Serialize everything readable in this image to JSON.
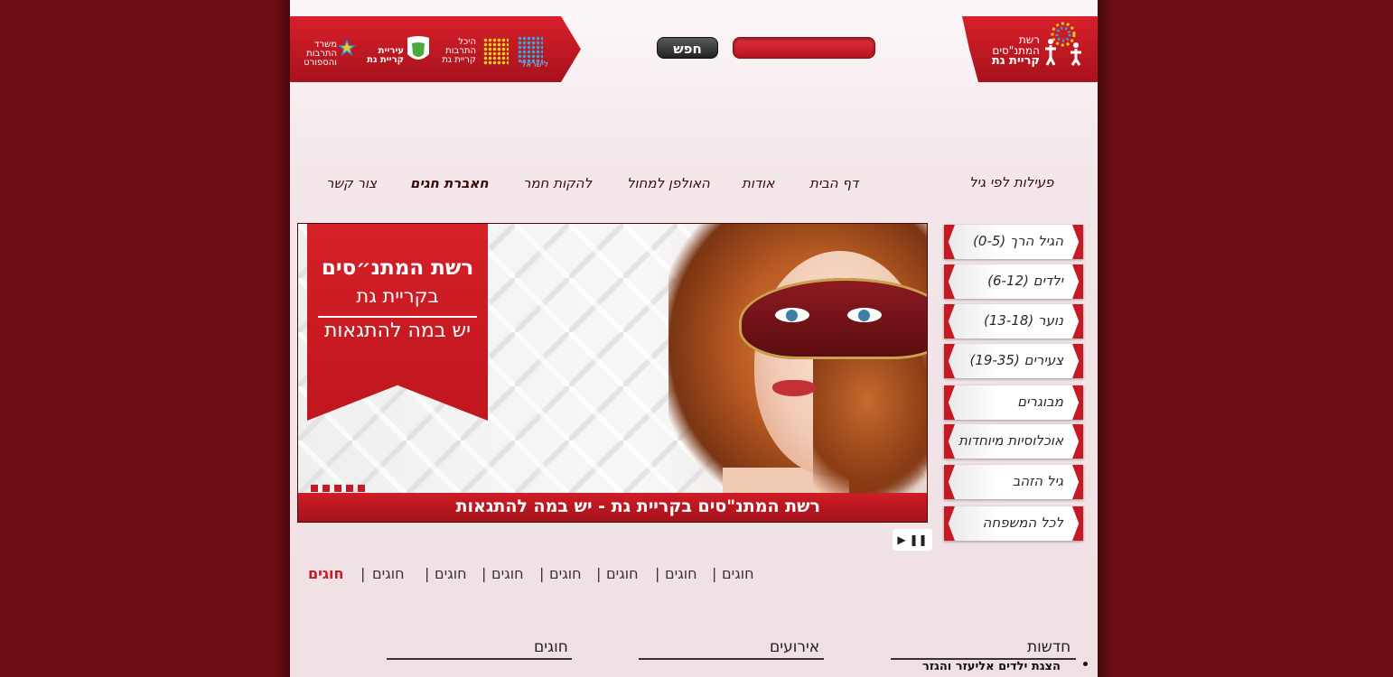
{
  "colors": {
    "brand_red": "#c51a24",
    "outer_bg": "#6e0e14"
  },
  "header": {
    "search_button": "חפש",
    "search_placeholder": "",
    "logo_right_line1": "רשת",
    "logo_right_line2": "המתנ\"סים",
    "logo_right_line3": "קריית גת",
    "logo_sport_line1": "משרד",
    "logo_sport_line2": "התרבות",
    "logo_sport_line3": "והספורט",
    "logo_city_line1": "עיריית",
    "logo_city_line2": "קריית גת",
    "logo_culture_line1": "היכל",
    "logo_culture_line2": "התרבות",
    "logo_culture_line3": "קריית גת",
    "logo_israel": "לישראל"
  },
  "nav": {
    "age_title": "פעילות לפי גיל",
    "items": [
      "דף הבית",
      "אודות",
      "האולפן למחול",
      "להקות חמר",
      "חאברת חגים",
      "צור קשר"
    ]
  },
  "sidebar": {
    "items": [
      "הגיל הרך (0-5)",
      "ילדים (6-12)",
      "נוער (13-18)",
      "צעירים (19-35)",
      "מבוגרים",
      "אוכלוסיות מיוחדות",
      "גיל הזהב",
      "לכל המשפחה"
    ]
  },
  "slider": {
    "ribbon_line1": "רשת המתנ״סים",
    "ribbon_line2": "בקריית גת",
    "ribbon_line3": "יש במה להתגאות",
    "caption": "רשת המתנ\"סים בקריית גת - יש במה להתגאות",
    "play_pause": "▶ ❚❚"
  },
  "links": {
    "items": [
      "חוגים",
      "חוגים",
      "חוגים",
      "חוגים",
      "חוגים",
      "חוגים",
      "חוגים",
      "חוגים"
    ],
    "separator": "|"
  },
  "columns": {
    "news_title": "חדשות",
    "events_title": "אירועים",
    "classes_title": "חוגים",
    "news_item_1": "הצגת ילדים אליעזר והגזר"
  }
}
